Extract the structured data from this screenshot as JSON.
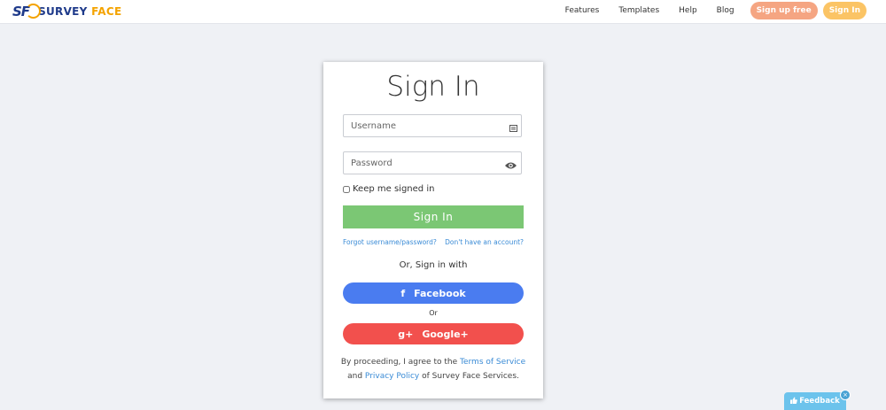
{
  "brand": {
    "logo_mark": "SF",
    "name_part1": "SURVEY",
    "name_part2": "FACE"
  },
  "nav": {
    "items": [
      {
        "label": "Features"
      },
      {
        "label": "Templates"
      },
      {
        "label": "Help"
      },
      {
        "label": "Blog"
      }
    ],
    "signup_label": "Sign up free",
    "signin_label": "Sign In"
  },
  "form": {
    "title": "Sign In",
    "username_placeholder": "Username",
    "password_placeholder": "Password",
    "keep_signed_in": "Keep me signed in",
    "submit_label": "Sign In",
    "forgot_link": "Forgot username/password?",
    "no_account_link": "Don't have an account?",
    "or_sign_in_with": "Or, Sign in with",
    "facebook_label": "Facebook",
    "or_label": "Or",
    "google_label": "Google+",
    "terms_prefix": "By proceeding, I agree to the",
    "terms_link": "Terms of Service",
    "terms_and": "and",
    "privacy_link": "Privacy Policy",
    "terms_suffix": "of Survey Face Services."
  },
  "feedback": {
    "label": "Feedback"
  },
  "colors": {
    "background": "#eff1f5",
    "signin_button": "#7bc774",
    "facebook": "#4a7cf0",
    "google": "#f2504d",
    "signup_pill": "#f5a582",
    "signin_pill": "#fbc465",
    "link": "#3a8bd6",
    "feedback": "#6cc3ec"
  },
  "icons": {
    "username_field": "id-card-icon",
    "password_field": "eye-icon",
    "facebook": "facebook-f-icon",
    "google": "google-plus-icon",
    "feedback": "thumbs-up-icon"
  }
}
